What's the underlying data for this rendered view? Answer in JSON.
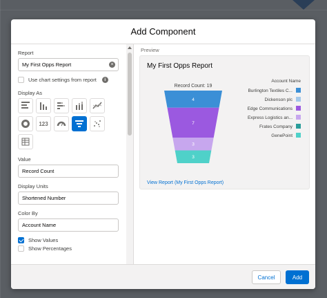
{
  "modal": {
    "title": "Add Component"
  },
  "left": {
    "report_label": "Report",
    "report_value": "My First Opps Report",
    "use_chart_settings_label": "Use chart settings from report",
    "display_as_label": "Display As",
    "display_icons": [
      "horizontal-bar-chart-icon",
      "vertical-bar-chart-icon",
      "stacked-horizontal-bar-icon",
      "stacked-vertical-bar-icon",
      "line-chart-icon",
      "donut-chart-icon",
      "metric-icon",
      "gauge-icon",
      "funnel-chart-icon",
      "scatter-plot-icon",
      "table-icon"
    ],
    "display_active": "funnel-chart-icon",
    "metric_text": "123",
    "value_label": "Value",
    "value_value": "Record Count",
    "display_units_label": "Display Units",
    "display_units_value": "Shortened Number",
    "color_by_label": "Color By",
    "color_by_value": "Account Name",
    "show_values_label": "Show Values",
    "show_values_checked": true,
    "show_percentages_label": "Show Percentages",
    "show_percentages_checked": false
  },
  "preview": {
    "label": "Preview",
    "title": "My First Opps Report",
    "view_report": "View Report (My First Opps Report)"
  },
  "chart_data": {
    "type": "funnel",
    "title": "Record Count: 19",
    "total": 19,
    "legend_title": "Account Name",
    "legend_position": "right",
    "series": [
      {
        "name": "Burlington Textiles C...",
        "value": 4,
        "color": "#3b8fd6"
      },
      {
        "name": "Dickenson plc",
        "value": 0,
        "color": "#a3c8ea"
      },
      {
        "name": "Edge Communications",
        "value": 7,
        "color": "#9b59e0"
      },
      {
        "name": "Express Logistics an...",
        "value": 3,
        "color": "#c7a7ee"
      },
      {
        "name": "Frates Company",
        "value": 0,
        "color": "#2a9d9a"
      },
      {
        "name": "GenePoint",
        "value": 3,
        "color": "#4fd1c9"
      }
    ],
    "segment_labels": [
      "4",
      "7",
      "3",
      "3"
    ]
  },
  "footer": {
    "cancel_label": "Cancel",
    "add_label": "Add"
  },
  "colors": {
    "brand": "#0070d2"
  }
}
